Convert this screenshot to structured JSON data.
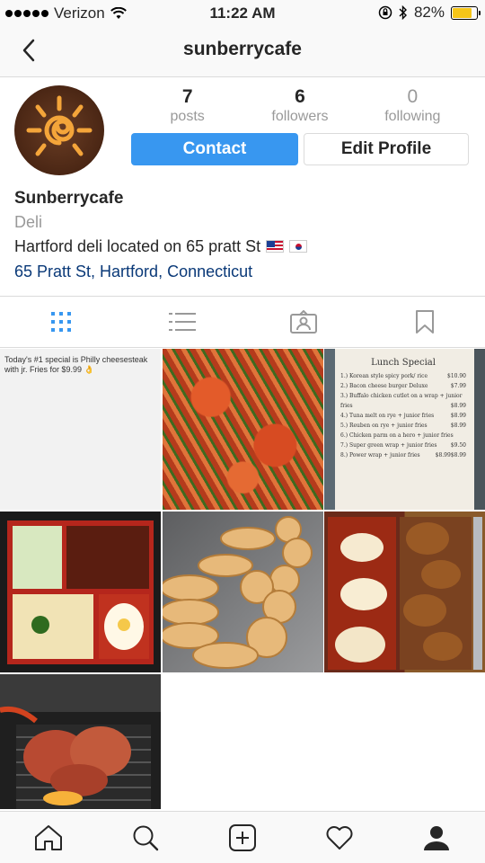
{
  "status_bar": {
    "carrier": "Verizon",
    "time": "11:22 AM",
    "battery": "82%",
    "battery_level": 0.82,
    "battery_color": "#f5c518"
  },
  "header": {
    "title": "sunberrycafe",
    "back_icon": "chevron-left-icon"
  },
  "profile": {
    "stats": [
      {
        "value": "7",
        "label": "posts"
      },
      {
        "value": "6",
        "label": "followers"
      },
      {
        "value": "0",
        "label": "following"
      }
    ],
    "contact_label": "Contact",
    "edit_label": "Edit Profile",
    "name": "Sunberrycafe",
    "category": "Deli",
    "description": "Hartford deli located on 65 pratt St",
    "address": "65 Pratt St, Hartford, Connecticut",
    "accent_color": "#3897f0",
    "link_color": "#0a3978"
  },
  "tabs": [
    {
      "icon": "grid-icon",
      "active": true
    },
    {
      "icon": "list-icon",
      "active": false
    },
    {
      "icon": "tagged-icon",
      "active": false
    },
    {
      "icon": "bookmark-icon",
      "active": false
    }
  ],
  "posts": {
    "post1_text": "Today's #1 special is Philly cheesesteak with jr. Fries for $9.99 👌",
    "menu": {
      "title": "Lunch Special",
      "items": [
        {
          "text": "1.) Korean style spicy pork/ rice",
          "price": "$10.90"
        },
        {
          "text": "2.) Bacon cheese burger Deluxe",
          "price": "$7.99"
        },
        {
          "text": "3.) Buffalo chicken cutlet on a wrap + junior fries",
          "price": "$8.99"
        },
        {
          "text": "4.) Tuna melt on rye + junior fries",
          "price": "$8.99"
        },
        {
          "text": "5.) Reuben on rye + junior fries",
          "price": "$8.99"
        },
        {
          "text": "6.) Chicken parm on a hero + junior fries",
          "price": "$9.50"
        },
        {
          "text": "7.) Super green wrap + junior fries",
          "price": "$8.99"
        },
        {
          "text": "8.) Power wrap + junior fries",
          "price": "$8.99"
        }
      ]
    }
  },
  "bottom_nav": [
    {
      "icon": "home-icon"
    },
    {
      "icon": "search-icon"
    },
    {
      "icon": "add-post-icon"
    },
    {
      "icon": "heart-icon"
    },
    {
      "icon": "profile-icon"
    }
  ]
}
